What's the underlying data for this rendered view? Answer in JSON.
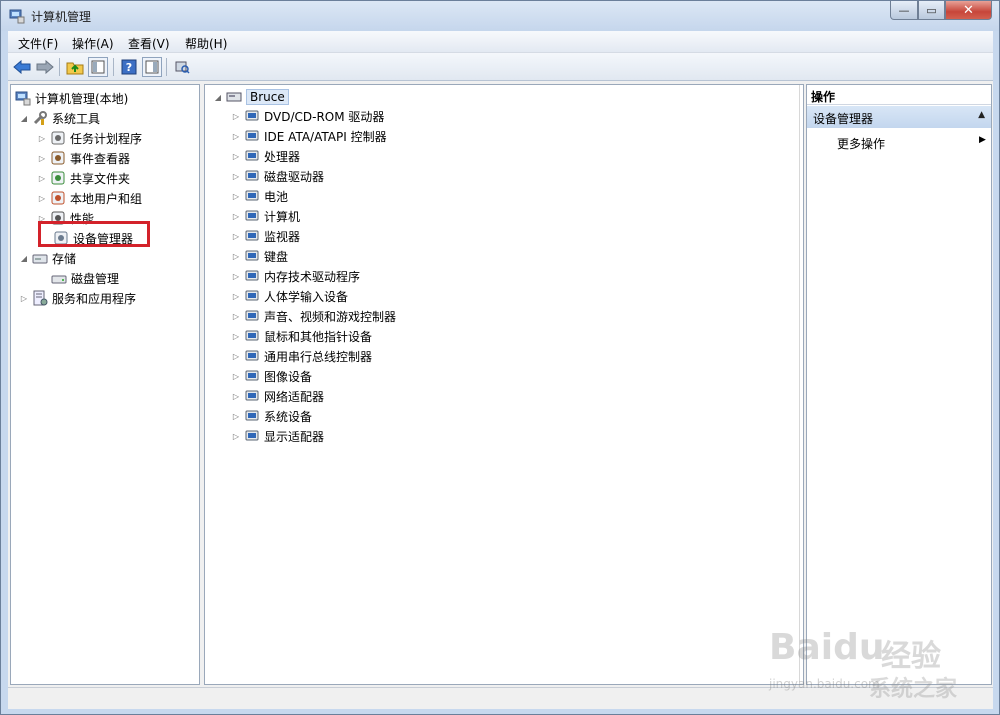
{
  "window": {
    "title": "计算机管理"
  },
  "menu": {
    "file": "文件(F)",
    "action": "操作(A)",
    "view": "查看(V)",
    "help": "帮助(H)"
  },
  "toolbar": {
    "icons": [
      "back-arrow-icon",
      "forward-arrow-icon",
      "up-folder-icon",
      "show-hide-console-tree-icon",
      "help-icon",
      "show-hide-action-pane-icon",
      "scan-hardware-icon"
    ]
  },
  "left_tree": {
    "root": "计算机管理(本地)",
    "system_tools": "系统工具",
    "items": [
      {
        "label": "任务计划程序",
        "icon": "clock-icon"
      },
      {
        "label": "事件查看器",
        "icon": "event-viewer-icon"
      },
      {
        "label": "共享文件夹",
        "icon": "shared-folder-icon"
      },
      {
        "label": "本地用户和组",
        "icon": "users-icon"
      },
      {
        "label": "性能",
        "icon": "performance-icon"
      },
      {
        "label": "设备管理器",
        "icon": "device-manager-icon"
      }
    ],
    "storage": "存储",
    "disk_management": "磁盘管理",
    "services_apps": "服务和应用程序"
  },
  "device_tree": {
    "root": "Bruce",
    "categories": [
      {
        "label": "DVD/CD-ROM 驱动器",
        "icon": "dvd-drive-icon"
      },
      {
        "label": "IDE ATA/ATAPI 控制器",
        "icon": "ide-controller-icon"
      },
      {
        "label": "处理器",
        "icon": "processor-icon"
      },
      {
        "label": "磁盘驱动器",
        "icon": "disk-drive-icon"
      },
      {
        "label": "电池",
        "icon": "battery-icon"
      },
      {
        "label": "计算机",
        "icon": "computer-icon"
      },
      {
        "label": "监视器",
        "icon": "monitor-icon"
      },
      {
        "label": "键盘",
        "icon": "keyboard-icon"
      },
      {
        "label": "内存技术驱动程序",
        "icon": "memory-icon"
      },
      {
        "label": "人体学输入设备",
        "icon": "hid-icon"
      },
      {
        "label": "声音、视频和游戏控制器",
        "icon": "speaker-icon"
      },
      {
        "label": "鼠标和其他指针设备",
        "icon": "mouse-icon"
      },
      {
        "label": "通用串行总线控制器",
        "icon": "usb-icon"
      },
      {
        "label": "图像设备",
        "icon": "imaging-icon"
      },
      {
        "label": "网络适配器",
        "icon": "network-icon"
      },
      {
        "label": "系统设备",
        "icon": "system-device-icon"
      },
      {
        "label": "显示适配器",
        "icon": "display-adapter-icon"
      }
    ]
  },
  "actions_pane": {
    "header": "操作",
    "section": "设备管理器",
    "more": "更多操作"
  },
  "watermark": {
    "brand": "Baidu",
    "brand_cn": "经验",
    "url": "jingyan.baidu.com",
    "site": "系统之家"
  },
  "colors": {
    "highlight_box": "#d3222a",
    "actions_section": "#c3d6ee"
  }
}
